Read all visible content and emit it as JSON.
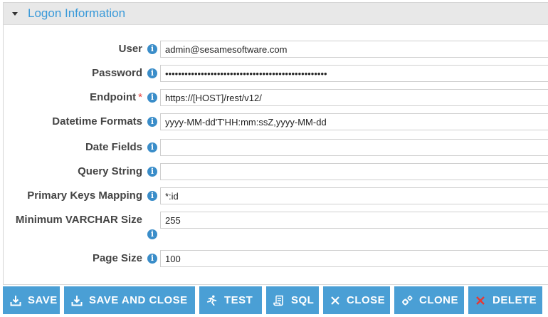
{
  "section": {
    "title": "Logon Information"
  },
  "fields": {
    "user": {
      "label": "User",
      "value": "admin@sesamesoftware.com"
    },
    "password": {
      "label": "Password",
      "value": "••••••••••••••••••••••••••••••••••••••••••••••••••"
    },
    "endpoint": {
      "label": "Endpoint",
      "required_mark": "*",
      "value": "https://[HOST]/rest/v12/"
    },
    "datetime_formats": {
      "label": "Datetime Formats",
      "value": "yyyy-MM-dd'T'HH:mm:ssZ,yyyy-MM-dd"
    },
    "date_fields": {
      "label": "Date Fields",
      "value": ""
    },
    "query_string": {
      "label": "Query String",
      "value": ""
    },
    "primary_keys_mapping": {
      "label": "Primary Keys Mapping",
      "value": "*:id"
    },
    "minimum_varchar_size": {
      "label": "Minimum VARCHAR Size",
      "value": "255"
    },
    "page_size": {
      "label": "Page Size",
      "value": "100"
    }
  },
  "info_glyph": "i",
  "toolbar": {
    "save": "SAVE",
    "save_and_close": "SAVE AND CLOSE",
    "test": "TEST",
    "sql": "SQL",
    "close": "CLOSE",
    "clone": "CLONE",
    "delete": "DELETE"
  },
  "colors": {
    "accent": "#3a9ad9",
    "button": "#4a9fd5",
    "info_icon": "#3a8dc9",
    "required": "#e53935",
    "delete_icon": "#e53935"
  }
}
